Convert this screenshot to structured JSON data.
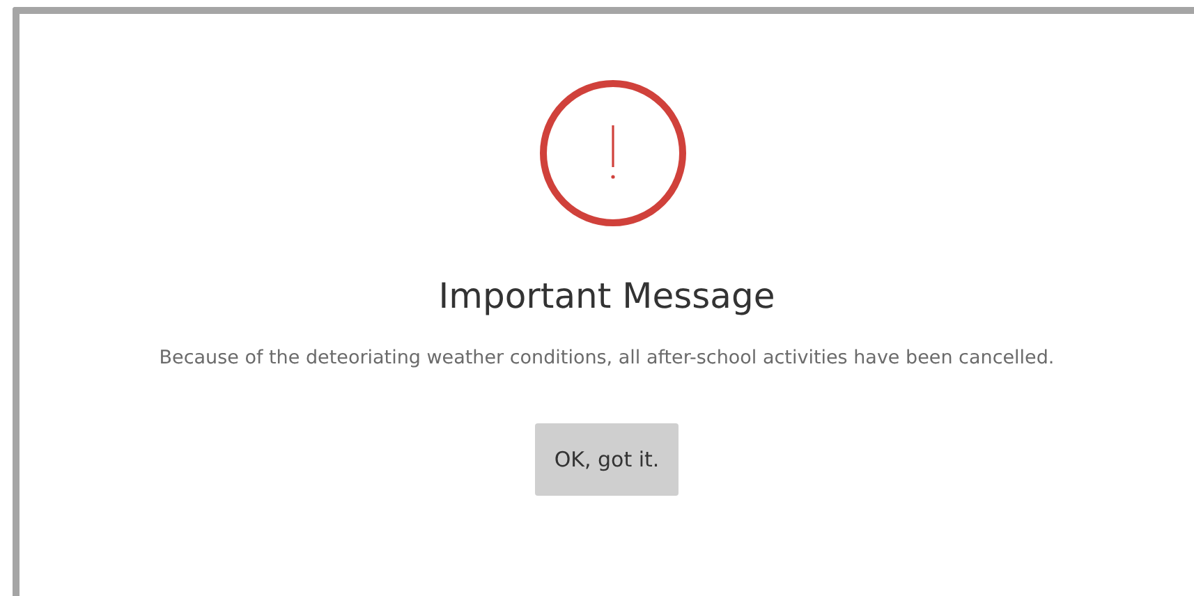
{
  "dialog": {
    "title": "Important Message",
    "message": "Because of the deteoriating weather conditions, all after-school activities have been cancelled.",
    "button": "OK, got it."
  }
}
